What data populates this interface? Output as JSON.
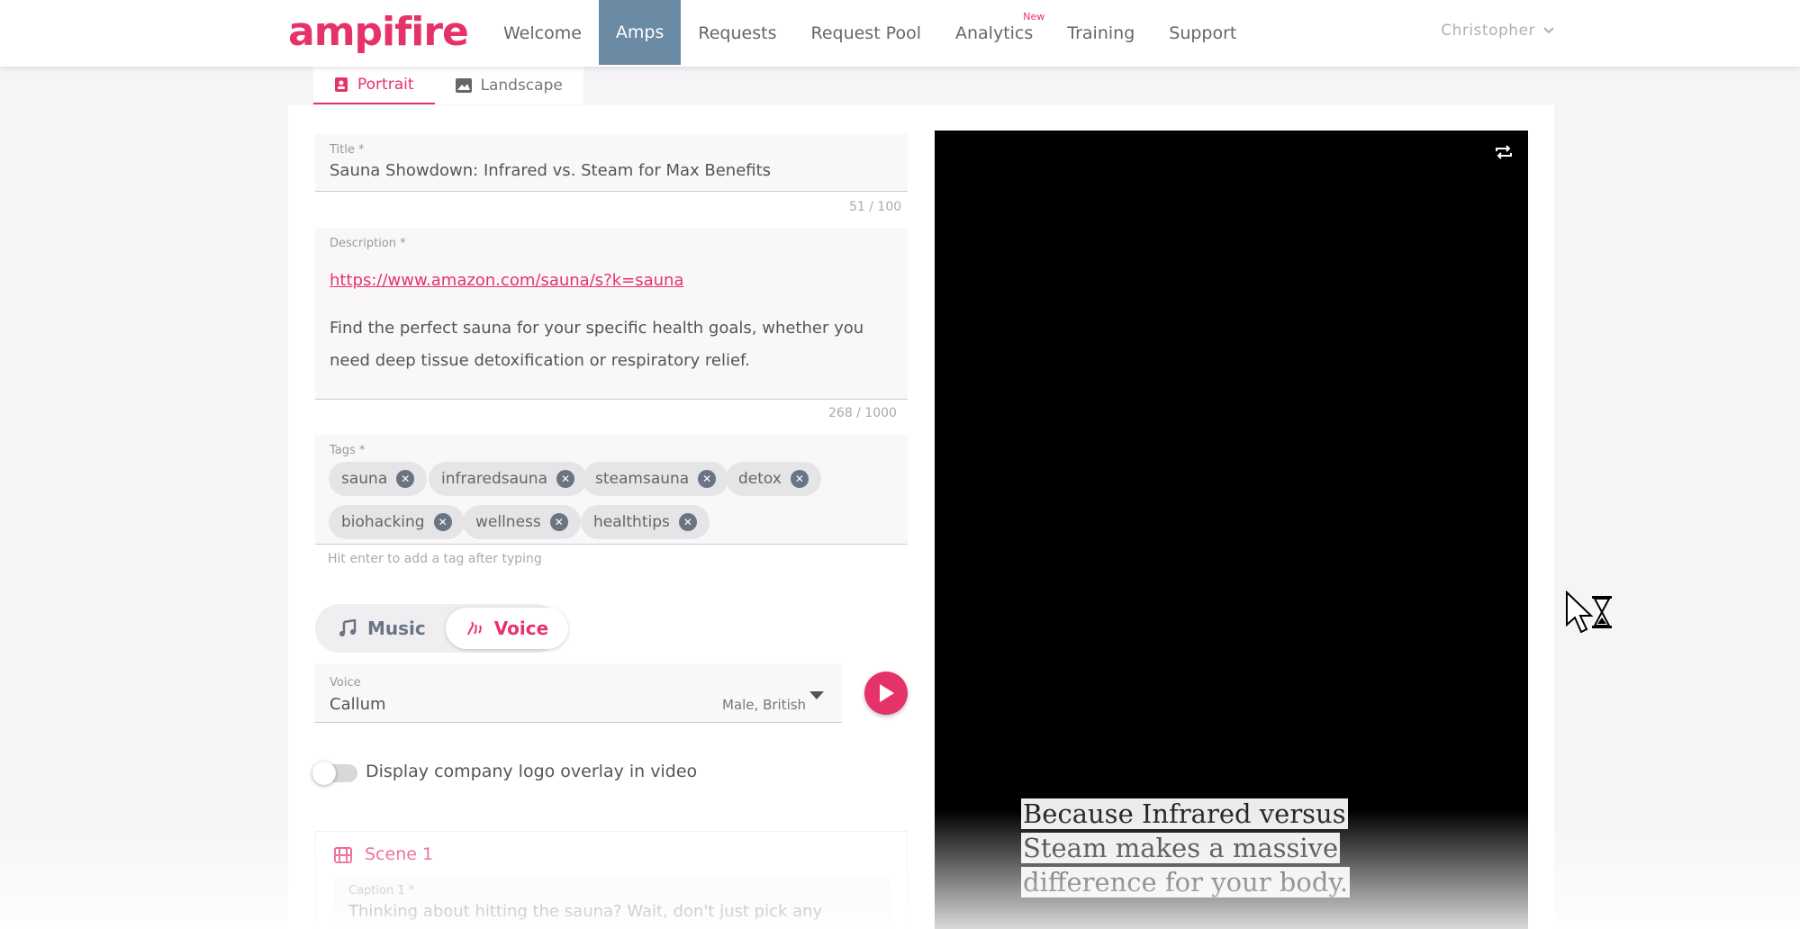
{
  "header": {
    "logo": "ampifire",
    "nav": [
      {
        "label": "Welcome",
        "active": false
      },
      {
        "label": "Amps",
        "active": true
      },
      {
        "label": "Requests",
        "active": false
      },
      {
        "label": "Request Pool",
        "active": false
      },
      {
        "label": "Analytics",
        "active": false,
        "badge": "New"
      },
      {
        "label": "Training",
        "active": false
      },
      {
        "label": "Support",
        "active": false
      }
    ],
    "user_name": "Christopher"
  },
  "tabs": [
    {
      "label": "Portrait",
      "icon": "portrait-icon",
      "active": true
    },
    {
      "label": "Landscape",
      "icon": "image-icon",
      "active": false
    }
  ],
  "form": {
    "title": {
      "label": "Title *",
      "value": "Sauna Showdown: Infrared vs. Steam for Max Benefits",
      "counter": "51 / 100"
    },
    "description": {
      "label": "Description *",
      "link": "https://www.amazon.com/sauna/s?k=sauna",
      "text": "Find the perfect sauna for your specific health goals, whether you need deep tissue detoxification or respiratory relief.",
      "counter": "268 / 1000"
    },
    "tags": {
      "label": "Tags *",
      "items": [
        "sauna",
        "infraredsauna",
        "steamsauna",
        "detox",
        "biohacking",
        "wellness",
        "healthtips"
      ],
      "hint": "Hit enter to add a tag after typing"
    },
    "audio_toggle": {
      "music": "Music",
      "voice": "Voice",
      "selected": "Voice"
    },
    "voice": {
      "label": "Voice",
      "value": "Callum",
      "detail": "Male, British"
    },
    "logo_overlay": {
      "label": "Display company logo overlay in video",
      "enabled": false
    },
    "scene": {
      "title": "Scene 1",
      "caption_label": "Caption 1 *",
      "caption_text": "Thinking about hitting the sauna? Wait, don't just pick any"
    }
  },
  "preview": {
    "subtitle": "Because Infrared versus Steam makes a massive difference for your body."
  },
  "colors": {
    "accent": "#e5336a",
    "nav_active": "#6b8aa3",
    "chip": "#e5e5e7"
  }
}
